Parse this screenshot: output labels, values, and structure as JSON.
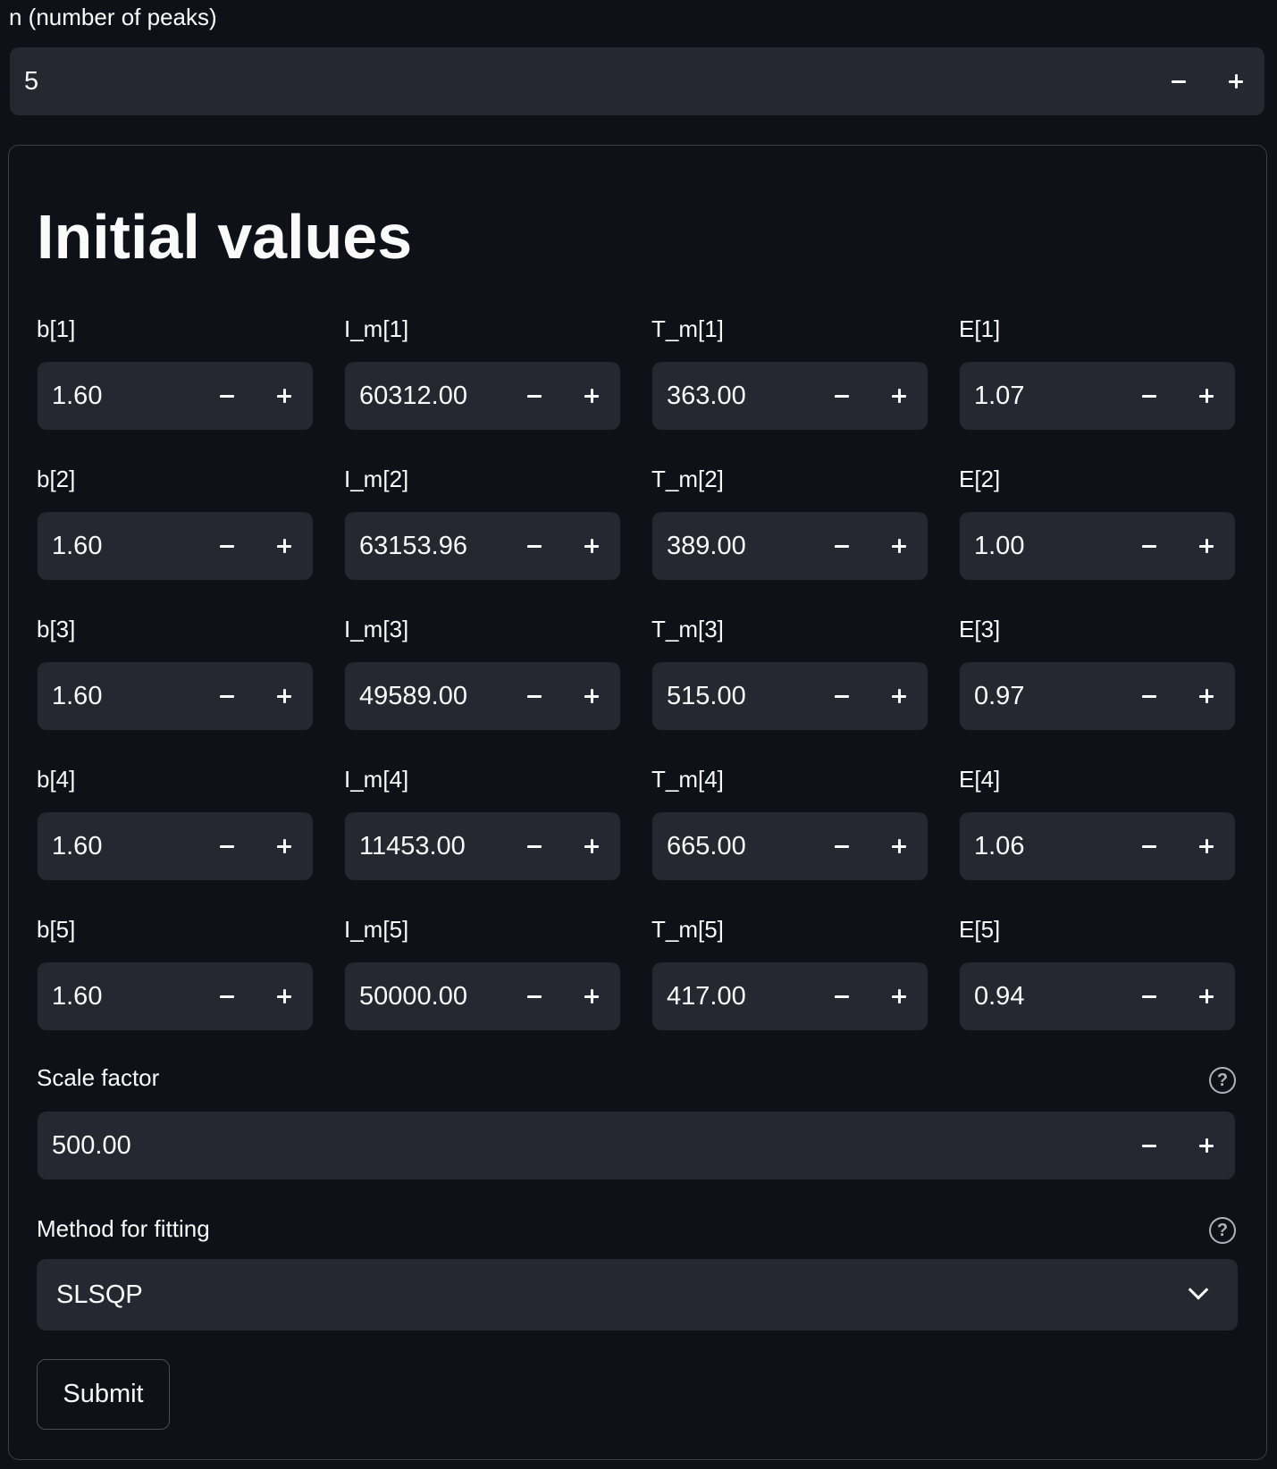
{
  "top": {
    "label": "n (number of peaks)",
    "value": "5"
  },
  "form": {
    "heading": "Initial values",
    "rows": [
      [
        {
          "label": "b[1]",
          "value": "1.60"
        },
        {
          "label": "I_m[1]",
          "value": "60312.00"
        },
        {
          "label": "T_m[1]",
          "value": "363.00"
        },
        {
          "label": "E[1]",
          "value": "1.07"
        }
      ],
      [
        {
          "label": "b[2]",
          "value": "1.60"
        },
        {
          "label": "I_m[2]",
          "value": "63153.96"
        },
        {
          "label": "T_m[2]",
          "value": "389.00"
        },
        {
          "label": "E[2]",
          "value": "1.00"
        }
      ],
      [
        {
          "label": "b[3]",
          "value": "1.60"
        },
        {
          "label": "I_m[3]",
          "value": "49589.00"
        },
        {
          "label": "T_m[3]",
          "value": "515.00"
        },
        {
          "label": "E[3]",
          "value": "0.97"
        }
      ],
      [
        {
          "label": "b[4]",
          "value": "1.60"
        },
        {
          "label": "I_m[4]",
          "value": "11453.00"
        },
        {
          "label": "T_m[4]",
          "value": "665.00"
        },
        {
          "label": "E[4]",
          "value": "1.06"
        }
      ],
      [
        {
          "label": "b[5]",
          "value": "1.60"
        },
        {
          "label": "I_m[5]",
          "value": "50000.00"
        },
        {
          "label": "T_m[5]",
          "value": "417.00"
        },
        {
          "label": "E[5]",
          "value": "0.94"
        }
      ]
    ],
    "scale": {
      "label": "Scale factor",
      "value": "500.00"
    },
    "method": {
      "label": "Method for fitting",
      "value": "SLSQP"
    },
    "submit_label": "Submit"
  }
}
